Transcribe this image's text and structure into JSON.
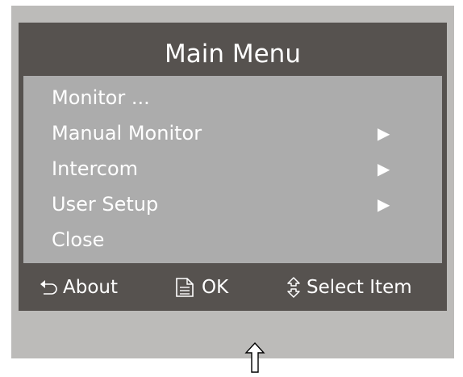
{
  "dialog": {
    "title": "Main Menu"
  },
  "menu": {
    "items": [
      {
        "label": "Monitor ...",
        "has_submenu": false,
        "icon": "none"
      },
      {
        "label": "Manual Monitor",
        "has_submenu": true,
        "icon": "submenu-arrow-icon"
      },
      {
        "label": "Intercom",
        "has_submenu": true,
        "icon": "submenu-arrow-icon"
      },
      {
        "label": "User Setup",
        "has_submenu": true,
        "icon": "submenu-arrow-icon"
      },
      {
        "label": "Close",
        "has_submenu": false,
        "icon": "none"
      }
    ]
  },
  "footer": {
    "about_label": "About",
    "ok_label": "OK",
    "select_label": "Select Item",
    "about_icon": "back-arrow-icon",
    "ok_icon": "document-icon",
    "select_icon": "up-down-arrow-icon"
  },
  "scroll_hint_icon": "up-arrow-icon",
  "arrow_glyph": "▶",
  "colors": {
    "screen_bg": "#bcbbb9",
    "dialog_bg": "#56524f",
    "menu_bg": "#acacac",
    "text": "#ffffff"
  }
}
